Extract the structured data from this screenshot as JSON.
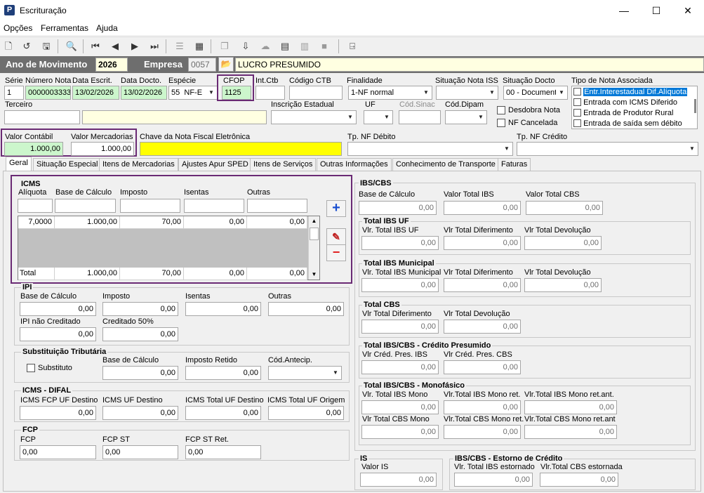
{
  "window": {
    "title": "Escrituração",
    "minimize": "—",
    "maximize": "☐",
    "close": "✕"
  },
  "menu": {
    "opcoes": "Opções",
    "ferramentas": "Ferramentas",
    "ajuda": "Ajuda"
  },
  "header": {
    "ano_label": "Ano de Movimento",
    "ano_value": "2026",
    "empresa_label": "Empresa",
    "empresa_code": "0057",
    "empresa_name": "LUCRO PRESUMIDO"
  },
  "row1": {
    "serie_label": "Série",
    "serie": "1",
    "numero_label": "Número Nota",
    "numero": "0000003333",
    "data_escrit_label": "Data Escrit.",
    "data_escrit": "13/02/2026",
    "data_docto_label": "Data Docto.",
    "data_docto": "13/02/2026",
    "especie_label": "Espécie",
    "especie_code": "55",
    "especie": "NF-E",
    "cfop_label": "CFOP",
    "cfop": "1125",
    "intctb_label": "Int.Ctb",
    "intctb": "",
    "codctb_label": "Código CTB",
    "codctb": "",
    "finalidade_label": "Finalidade",
    "finalidade": "1-NF normal",
    "sit_iss_label": "Situação Nota ISS",
    "sit_iss": "",
    "sit_docto_label": "Situação Docto",
    "sit_docto": "00 - Document",
    "tipo_assoc_label": "Tipo de Nota Associada",
    "tipo_assoc_items": [
      "Entr.Interestadual Dif.Alíquota",
      "Entrada com ICMS Diferido",
      "Entrada de Produtor Rural",
      "Entrada de saída sem débito"
    ]
  },
  "row2": {
    "terceiro_label": "Terceiro",
    "terceiro": "",
    "terceiro_name": "",
    "ie_label": "Inscrição Estadual",
    "ie": "",
    "uf_label": "UF",
    "uf": "",
    "codsinac_label": "Cód.Sinac",
    "codsinac": "",
    "coddipam_label": "Cód.Dipam",
    "coddipam": "",
    "desdobra_label": "Desdobra Nota",
    "cancelada_label": "NF Cancelada"
  },
  "row3": {
    "valor_contabil_label": "Valor Contábil",
    "valor_contabil": "1.000,00",
    "valor_merc_label": "Valor Mercadorias",
    "valor_merc": "1.000,00",
    "chave_label": "Chave da Nota Fiscal Eletrônica",
    "chave": "",
    "tp_debito_label": "Tp. NF Débito",
    "tp_debito": "",
    "tp_credito_label": "Tp. NF Crédito",
    "tp_credito": ""
  },
  "tabs": [
    "Geral",
    "Situação Especial",
    "Itens de Mercadorias",
    "Ajustes Apur SPED",
    "Itens de Serviços",
    "Outras Informações",
    "Conhecimento de Transporte",
    "Faturas"
  ],
  "icms": {
    "title": "ICMS",
    "cols": [
      "Alíquota",
      "Base de Cálculo",
      "Imposto",
      "Isentas",
      "Outras"
    ],
    "row": [
      "7,0000",
      "1.000,00",
      "70,00",
      "0,00",
      "0,00"
    ],
    "total_label": "Total",
    "total": [
      "1.000,00",
      "70,00",
      "0,00",
      "0,00"
    ]
  },
  "ipi": {
    "title": "IPI",
    "base_label": "Base de Cálculo",
    "base": "0,00",
    "imposto_label": "Imposto",
    "imposto": "0,00",
    "isentas_label": "Isentas",
    "isentas": "0,00",
    "outras_label": "Outras",
    "outras": "0,00",
    "nao_cred_label": "IPI não Creditado",
    "nao_cred": "0,00",
    "cred50_label": "Creditado 50%",
    "cred50": "0,00"
  },
  "st": {
    "title": "Substituição Tributária",
    "substituto_label": "Substituto",
    "base_label": "Base de Cálculo",
    "base": "0,00",
    "retido_label": "Imposto Retido",
    "retido": "0,00",
    "antecip_label": "Cód.Antecip.",
    "antecip": ""
  },
  "difal": {
    "title": "ICMS - DIFAL",
    "fcp_label": "ICMS FCP UF Destino",
    "fcp": "0,00",
    "uf_dest_label": "ICMS UF Destino",
    "uf_dest": "0,00",
    "total_dest_label": "ICMS Total UF Destino",
    "total_dest": "0,00",
    "total_orig_label": "ICMS Total UF Origem",
    "total_orig": "0,00"
  },
  "fcp": {
    "title": "FCP",
    "fcp_label": "FCP",
    "fcp": "0,00",
    "fcpst_label": "FCP ST",
    "fcpst": "0,00",
    "fcpstret_label": "FCP ST Ret.",
    "fcpstret": "0,00"
  },
  "ibscbs": {
    "title": "IBS/CBS",
    "base_label": "Base de Cálculo",
    "base": "0,00",
    "total_ibs_label": "Valor Total IBS",
    "total_ibs": "0,00",
    "total_cbs_label": "Valor Total CBS",
    "total_cbs": "0,00"
  },
  "ibs_uf": {
    "title": "Total IBS UF",
    "a_label": "Vlr. Total IBS UF",
    "a": "0,00",
    "b_label": "Vlr Total Diferimento",
    "b": "0,00",
    "c_label": "Vlr Total Devolução",
    "c": "0,00"
  },
  "ibs_mun": {
    "title": "Total IBS Municipal",
    "a_label": "Vlr. Total IBS Municipal",
    "a": "0,00",
    "b_label": "Vlr Total Diferimento",
    "b": "0,00",
    "c_label": "Vlr Total Devolução",
    "c": "0,00"
  },
  "cbs": {
    "title": "Total CBS",
    "a_label": "Vlr Total Diferimento",
    "a": "0,00",
    "b_label": "Vlr Total Devolução",
    "b": "0,00"
  },
  "cred_pres": {
    "title": "Total IBS/CBS - Crédito Presumido",
    "a_label": "Vlr Créd. Pres. IBS",
    "a": "0,00",
    "b_label": "Vlr Créd. Pres. CBS",
    "b": "0,00"
  },
  "mono": {
    "title": "Total IBS/CBS - Monofásico",
    "a_label": "Vlr. Total IBS Mono",
    "a": "0,00",
    "b_label": "Vlr.Total IBS Mono ret.",
    "b": "0,00",
    "c_label": "Vlr.Total IBS Mono ret.ant.",
    "c": "0,00",
    "d_label": "Vlr Total CBS Mono",
    "d": "0,00",
    "e_label": "Vlr.Total CBS Mono ret.",
    "e": "0,00",
    "f_label": "Vlr.Total CBS Mono ret.ant",
    "f": "0,00"
  },
  "is": {
    "title": "IS",
    "valor_label": "Valor IS",
    "valor": "0,00"
  },
  "estorno": {
    "title": "IBS/CBS - Estorno de Crédito",
    "a_label": "Vlr. Total IBS estornado",
    "a": "0,00",
    "b_label": "Vlr.Total CBS estornada",
    "b": "0,00"
  },
  "colors": {
    "purple_highlight": "#6a2a74",
    "green_field": "#ccf6cc",
    "yellow_field": "#ffff00",
    "selection": "#0078d7"
  }
}
